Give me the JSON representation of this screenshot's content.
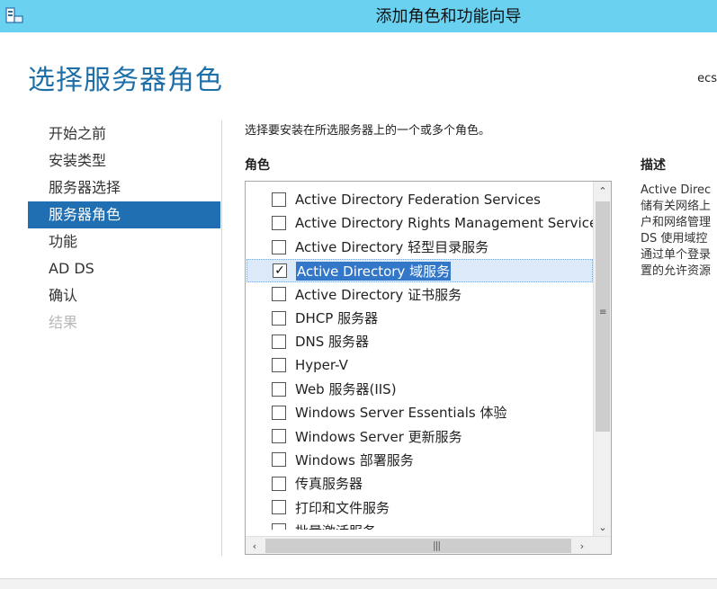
{
  "window": {
    "title": "添加角色和功能向导"
  },
  "page": {
    "title": "选择服务器角色",
    "server_name": "ecs"
  },
  "nav": {
    "items": [
      {
        "label": "开始之前",
        "state": "normal"
      },
      {
        "label": "安装类型",
        "state": "normal"
      },
      {
        "label": "服务器选择",
        "state": "normal"
      },
      {
        "label": "服务器角色",
        "state": "active"
      },
      {
        "label": "功能",
        "state": "normal"
      },
      {
        "label": "AD DS",
        "state": "normal"
      },
      {
        "label": "确认",
        "state": "normal"
      },
      {
        "label": "结果",
        "state": "disabled"
      }
    ]
  },
  "roles": {
    "instruction": "选择要安装在所选服务器上的一个或多个角色。",
    "header": "角色",
    "items": [
      {
        "label": "Active Directory Federation Services",
        "checked": false
      },
      {
        "label": "Active Directory Rights Management Services",
        "checked": false
      },
      {
        "label": "Active Directory 轻型目录服务",
        "checked": false
      },
      {
        "label": "Active Directory 域服务",
        "checked": true,
        "selected": true
      },
      {
        "label": "Active Directory 证书服务",
        "checked": false
      },
      {
        "label": "DHCP 服务器",
        "checked": false
      },
      {
        "label": "DNS 服务器",
        "checked": false
      },
      {
        "label": "Hyper-V",
        "checked": false
      },
      {
        "label": "Web 服务器(IIS)",
        "checked": false
      },
      {
        "label": "Windows Server Essentials 体验",
        "checked": false
      },
      {
        "label": "Windows Server 更新服务",
        "checked": false
      },
      {
        "label": "Windows 部署服务",
        "checked": false
      },
      {
        "label": "传真服务器",
        "checked": false
      },
      {
        "label": "打印和文件服务",
        "checked": false
      },
      {
        "label": "批量激活服务",
        "checked": false
      }
    ]
  },
  "description": {
    "header": "描述",
    "text": "Active Direc\n储有关网络上\n户和网络管理\nDS 使用域控\n通过单个登录\n置的允许资源"
  },
  "icons": {
    "checkmark": "✓",
    "scroll_up": "⌃",
    "scroll_down": "⌄",
    "scroll_left": "‹",
    "scroll_right": "›",
    "grip": "≡"
  },
  "colors": {
    "titlebar": "#6ad1f0",
    "accent": "#1f6fb2",
    "page_title": "#1e6fa8",
    "selection_bg": "#dbe9f8",
    "label_highlight": "#3377c9"
  }
}
